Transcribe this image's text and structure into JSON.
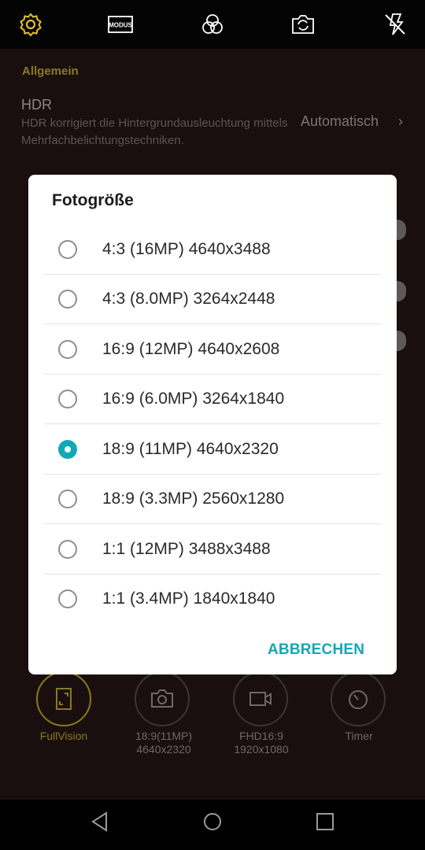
{
  "topbar": {
    "icons": [
      "settings-gear-icon",
      "modus-icon",
      "filters-icon",
      "switch-camera-icon",
      "flash-off-icon"
    ],
    "modus_label": "MODUS",
    "accent_color": "#e2c12a"
  },
  "settings": {
    "section_general": "Allgemein",
    "hdr_title": "HDR",
    "hdr_desc": "HDR korrigiert die Hintergrundausleuchtung mittels Mehrfachbelichtungstechniken.",
    "hdr_value": "Automatisch",
    "hdr_chevron": "›"
  },
  "dialog": {
    "title": "Fotogröße",
    "options": [
      {
        "label": "4:3 (16MP) 4640x3488",
        "selected": false
      },
      {
        "label": "4:3 (8.0MP) 3264x2448",
        "selected": false
      },
      {
        "label": "16:9 (12MP) 4640x2608",
        "selected": false
      },
      {
        "label": "16:9 (6.0MP) 3264x1840",
        "selected": false
      },
      {
        "label": "18:9 (11MP) 4640x2320",
        "selected": true
      },
      {
        "label": "18:9 (3.3MP) 2560x1280",
        "selected": false
      },
      {
        "label": "1:1 (12MP) 3488x3488",
        "selected": false
      },
      {
        "label": "1:1 (3.4MP) 1840x1840",
        "selected": false
      }
    ],
    "cancel_label": "ABBRECHEN",
    "accent_color": "#12a8b4"
  },
  "modes": [
    {
      "label": "FullVision",
      "icon": "fullvision-icon",
      "active": true
    },
    {
      "label": "18:9(11MP)\n4640x2320",
      "icon": "camera-icon",
      "active": false
    },
    {
      "label": "FHD16:9\n1920x1080",
      "icon": "video-icon",
      "active": false
    },
    {
      "label": "Timer",
      "icon": "timer-icon",
      "active": false
    }
  ],
  "navbar": {
    "icons": [
      "back-icon",
      "home-icon",
      "recents-icon"
    ]
  }
}
